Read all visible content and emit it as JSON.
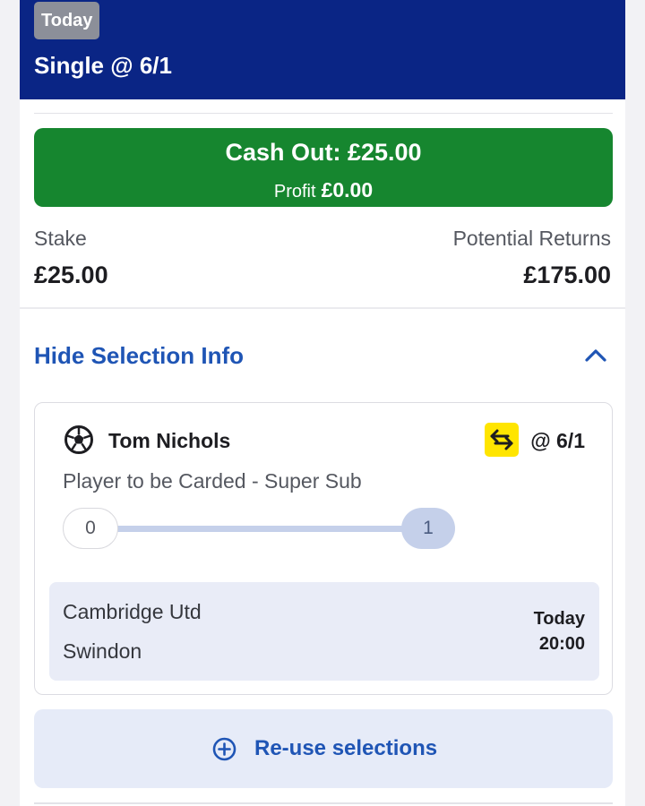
{
  "header": {
    "badge": "Today",
    "title": "Single @ 6/1",
    "background_color": "#0a2585"
  },
  "cash_out": {
    "label": "Cash Out: £25.00",
    "profit_label": "Profit",
    "profit_value": "£0.00",
    "color": "#16862f"
  },
  "stake": {
    "label": "Stake",
    "value": "£25.00"
  },
  "returns": {
    "label": "Potential Returns",
    "value": "£175.00"
  },
  "selection_info": {
    "toggle_label": "Hide Selection Info",
    "toggle_icon": "chevron-up-icon"
  },
  "selection": {
    "sport_icon": "football-icon",
    "player": "Tom Nichols",
    "swap_icon": "swap-arrows-icon",
    "odds": "@ 6/1",
    "market": "Player to be Carded - Super Sub",
    "progress": {
      "start": "0",
      "end": "1",
      "current": 1
    },
    "event": {
      "home": "Cambridge Utd",
      "away": "Swindon",
      "day": "Today",
      "time": "20:00"
    }
  },
  "reuse": {
    "icon": "plus-circle-icon",
    "label": "Re-use selections"
  },
  "colors": {
    "link_blue": "#1f55b5",
    "accent_yellow": "#ffe500"
  }
}
